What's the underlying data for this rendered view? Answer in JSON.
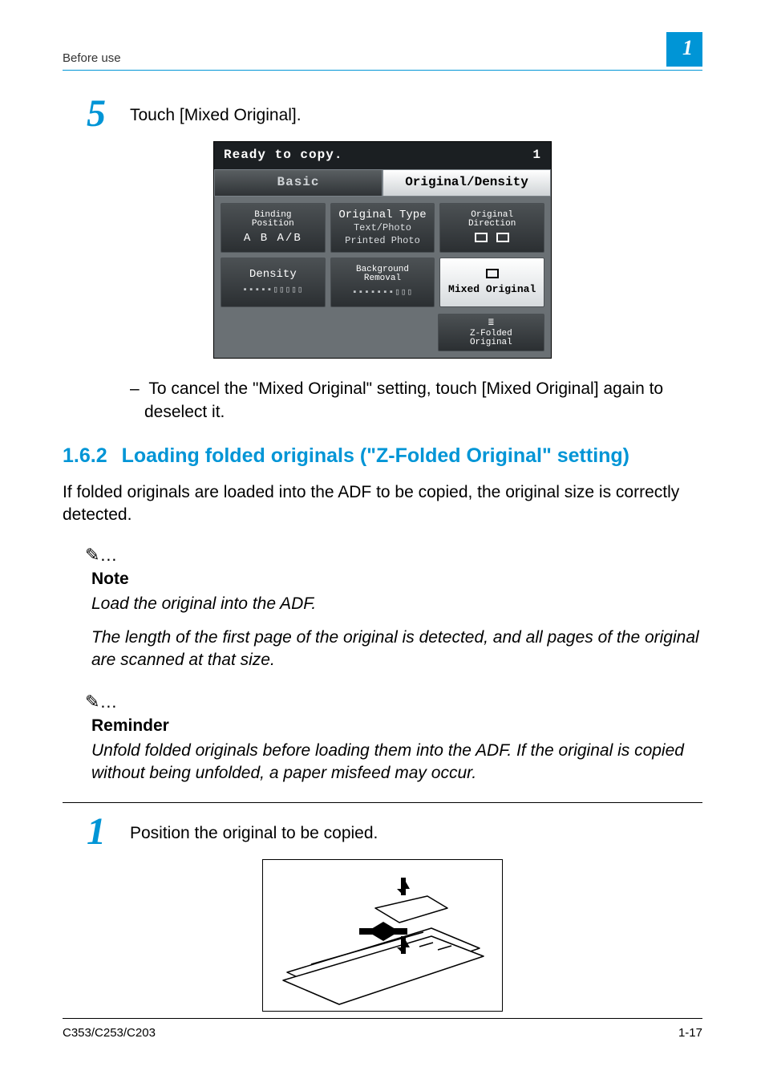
{
  "header": {
    "running_title": "Before use",
    "chapter_badge": "1"
  },
  "step5": {
    "number": "5",
    "text": "Touch [Mixed Original].",
    "sub_dash": "–",
    "sub_note": "To cancel the \"Mixed Original\" setting, touch [Mixed Original] again to deselect it."
  },
  "screen": {
    "status_left": "Ready to copy.",
    "status_right": "1",
    "tab_basic": "Basic",
    "tab_origdens": "Original/Density",
    "btn_binding": "Binding\nPosition",
    "btn_binding_icons": "A B  A/B",
    "btn_origtype_title": "Original Type",
    "btn_origtype_l1": "Text/Photo",
    "btn_origtype_l2": "Printed Photo",
    "btn_origdir": "Original\nDirection",
    "btn_density": "Density",
    "btn_bgremoval": "Background\nRemoval",
    "btn_mixed": "Mixed Original",
    "btn_zfolded": "Z-Folded\nOriginal"
  },
  "section162": {
    "num": "1.6.2",
    "title": "Loading folded originals (\"Z-Folded Original\" setting)",
    "intro": "If folded originals are loaded into the ADF to be copied, the original size is correctly detected."
  },
  "note": {
    "icon": "✎…",
    "title": "Note",
    "line1": "Load the original into the ADF.",
    "line2": "The length of the first page of the original is detected, and all pages of the original are scanned at that size."
  },
  "reminder": {
    "icon": "✎…",
    "title": "Reminder",
    "line": "Unfold folded originals before loading them into the ADF. If the original is copied without being unfolded, a paper misfeed may occur."
  },
  "step1": {
    "number": "1",
    "text": "Position the original to be copied."
  },
  "footer": {
    "model": "C353/C253/C203",
    "page": "1-17"
  }
}
